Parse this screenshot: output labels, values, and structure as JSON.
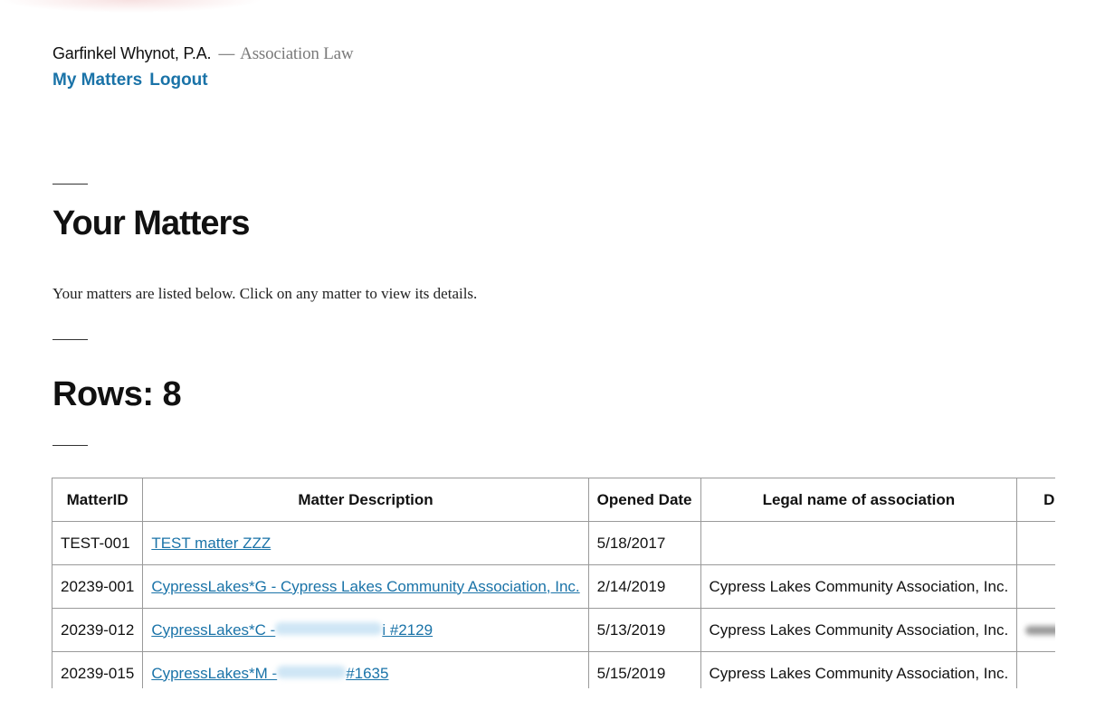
{
  "header": {
    "firm_name": "Garfinkel Whynot, P.A.",
    "separator": "—",
    "tagline": "Association Law",
    "nav": [
      {
        "label": "My Matters"
      },
      {
        "label": "Logout"
      }
    ]
  },
  "main": {
    "title": "Your Matters",
    "intro": "Your matters are listed below. Click on any matter to view its details.",
    "rows_count": "Rows: 8"
  },
  "table": {
    "columns": [
      "MatterID",
      "Matter Description",
      "Opened Date",
      "Legal name of association",
      "D"
    ],
    "rows": [
      {
        "id": "TEST-001",
        "desc_prefix": "TEST matter ZZZ",
        "desc_suffix": "",
        "opened": "5/18/2017",
        "legal": "",
        "extra": ""
      },
      {
        "id": "20239-001",
        "desc_prefix": "CypressLakes*G - Cypress Lakes Community Association, Inc.",
        "desc_suffix": "",
        "opened": "2/14/2019",
        "legal": "Cypress Lakes Community Association, Inc.",
        "extra": ""
      },
      {
        "id": "20239-012",
        "desc_prefix": "CypressLakes*C -",
        "desc_suffix": "i #2129",
        "opened": "5/13/2019",
        "legal": "Cypress Lakes Community Association, Inc.",
        "extra": "redacted"
      },
      {
        "id": "20239-015",
        "desc_prefix": "CypressLakes*M -",
        "desc_suffix": "#1635",
        "opened": "5/15/2019",
        "legal": "Cypress Lakes Community Association, Inc.",
        "extra": ""
      }
    ]
  },
  "colors": {
    "link": "#1a73a8",
    "text": "#111111",
    "border": "#9a9a9a"
  }
}
